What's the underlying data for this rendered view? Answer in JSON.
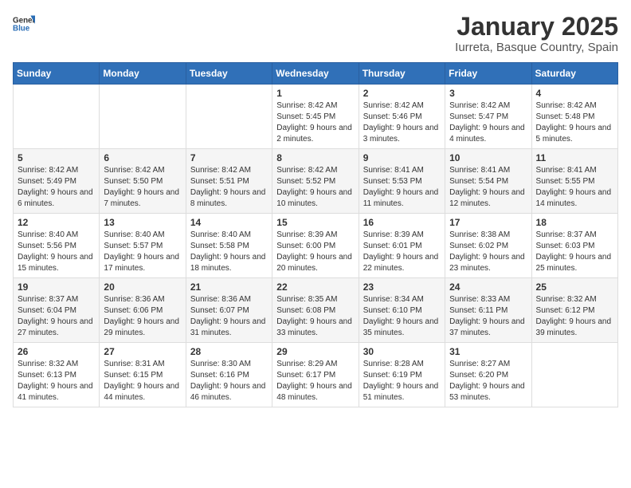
{
  "header": {
    "logo_general": "General",
    "logo_blue": "Blue",
    "title": "January 2025",
    "subtitle": "Iurreta, Basque Country, Spain"
  },
  "weekdays": [
    "Sunday",
    "Monday",
    "Tuesday",
    "Wednesday",
    "Thursday",
    "Friday",
    "Saturday"
  ],
  "weeks": [
    [
      {
        "day": "",
        "sunrise": "",
        "sunset": "",
        "daylight": ""
      },
      {
        "day": "",
        "sunrise": "",
        "sunset": "",
        "daylight": ""
      },
      {
        "day": "",
        "sunrise": "",
        "sunset": "",
        "daylight": ""
      },
      {
        "day": "1",
        "sunrise": "Sunrise: 8:42 AM",
        "sunset": "Sunset: 5:45 PM",
        "daylight": "Daylight: 9 hours and 2 minutes."
      },
      {
        "day": "2",
        "sunrise": "Sunrise: 8:42 AM",
        "sunset": "Sunset: 5:46 PM",
        "daylight": "Daylight: 9 hours and 3 minutes."
      },
      {
        "day": "3",
        "sunrise": "Sunrise: 8:42 AM",
        "sunset": "Sunset: 5:47 PM",
        "daylight": "Daylight: 9 hours and 4 minutes."
      },
      {
        "day": "4",
        "sunrise": "Sunrise: 8:42 AM",
        "sunset": "Sunset: 5:48 PM",
        "daylight": "Daylight: 9 hours and 5 minutes."
      }
    ],
    [
      {
        "day": "5",
        "sunrise": "Sunrise: 8:42 AM",
        "sunset": "Sunset: 5:49 PM",
        "daylight": "Daylight: 9 hours and 6 minutes."
      },
      {
        "day": "6",
        "sunrise": "Sunrise: 8:42 AM",
        "sunset": "Sunset: 5:50 PM",
        "daylight": "Daylight: 9 hours and 7 minutes."
      },
      {
        "day": "7",
        "sunrise": "Sunrise: 8:42 AM",
        "sunset": "Sunset: 5:51 PM",
        "daylight": "Daylight: 9 hours and 8 minutes."
      },
      {
        "day": "8",
        "sunrise": "Sunrise: 8:42 AM",
        "sunset": "Sunset: 5:52 PM",
        "daylight": "Daylight: 9 hours and 10 minutes."
      },
      {
        "day": "9",
        "sunrise": "Sunrise: 8:41 AM",
        "sunset": "Sunset: 5:53 PM",
        "daylight": "Daylight: 9 hours and 11 minutes."
      },
      {
        "day": "10",
        "sunrise": "Sunrise: 8:41 AM",
        "sunset": "Sunset: 5:54 PM",
        "daylight": "Daylight: 9 hours and 12 minutes."
      },
      {
        "day": "11",
        "sunrise": "Sunrise: 8:41 AM",
        "sunset": "Sunset: 5:55 PM",
        "daylight": "Daylight: 9 hours and 14 minutes."
      }
    ],
    [
      {
        "day": "12",
        "sunrise": "Sunrise: 8:40 AM",
        "sunset": "Sunset: 5:56 PM",
        "daylight": "Daylight: 9 hours and 15 minutes."
      },
      {
        "day": "13",
        "sunrise": "Sunrise: 8:40 AM",
        "sunset": "Sunset: 5:57 PM",
        "daylight": "Daylight: 9 hours and 17 minutes."
      },
      {
        "day": "14",
        "sunrise": "Sunrise: 8:40 AM",
        "sunset": "Sunset: 5:58 PM",
        "daylight": "Daylight: 9 hours and 18 minutes."
      },
      {
        "day": "15",
        "sunrise": "Sunrise: 8:39 AM",
        "sunset": "Sunset: 6:00 PM",
        "daylight": "Daylight: 9 hours and 20 minutes."
      },
      {
        "day": "16",
        "sunrise": "Sunrise: 8:39 AM",
        "sunset": "Sunset: 6:01 PM",
        "daylight": "Daylight: 9 hours and 22 minutes."
      },
      {
        "day": "17",
        "sunrise": "Sunrise: 8:38 AM",
        "sunset": "Sunset: 6:02 PM",
        "daylight": "Daylight: 9 hours and 23 minutes."
      },
      {
        "day": "18",
        "sunrise": "Sunrise: 8:37 AM",
        "sunset": "Sunset: 6:03 PM",
        "daylight": "Daylight: 9 hours and 25 minutes."
      }
    ],
    [
      {
        "day": "19",
        "sunrise": "Sunrise: 8:37 AM",
        "sunset": "Sunset: 6:04 PM",
        "daylight": "Daylight: 9 hours and 27 minutes."
      },
      {
        "day": "20",
        "sunrise": "Sunrise: 8:36 AM",
        "sunset": "Sunset: 6:06 PM",
        "daylight": "Daylight: 9 hours and 29 minutes."
      },
      {
        "day": "21",
        "sunrise": "Sunrise: 8:36 AM",
        "sunset": "Sunset: 6:07 PM",
        "daylight": "Daylight: 9 hours and 31 minutes."
      },
      {
        "day": "22",
        "sunrise": "Sunrise: 8:35 AM",
        "sunset": "Sunset: 6:08 PM",
        "daylight": "Daylight: 9 hours and 33 minutes."
      },
      {
        "day": "23",
        "sunrise": "Sunrise: 8:34 AM",
        "sunset": "Sunset: 6:10 PM",
        "daylight": "Daylight: 9 hours and 35 minutes."
      },
      {
        "day": "24",
        "sunrise": "Sunrise: 8:33 AM",
        "sunset": "Sunset: 6:11 PM",
        "daylight": "Daylight: 9 hours and 37 minutes."
      },
      {
        "day": "25",
        "sunrise": "Sunrise: 8:32 AM",
        "sunset": "Sunset: 6:12 PM",
        "daylight": "Daylight: 9 hours and 39 minutes."
      }
    ],
    [
      {
        "day": "26",
        "sunrise": "Sunrise: 8:32 AM",
        "sunset": "Sunset: 6:13 PM",
        "daylight": "Daylight: 9 hours and 41 minutes."
      },
      {
        "day": "27",
        "sunrise": "Sunrise: 8:31 AM",
        "sunset": "Sunset: 6:15 PM",
        "daylight": "Daylight: 9 hours and 44 minutes."
      },
      {
        "day": "28",
        "sunrise": "Sunrise: 8:30 AM",
        "sunset": "Sunset: 6:16 PM",
        "daylight": "Daylight: 9 hours and 46 minutes."
      },
      {
        "day": "29",
        "sunrise": "Sunrise: 8:29 AM",
        "sunset": "Sunset: 6:17 PM",
        "daylight": "Daylight: 9 hours and 48 minutes."
      },
      {
        "day": "30",
        "sunrise": "Sunrise: 8:28 AM",
        "sunset": "Sunset: 6:19 PM",
        "daylight": "Daylight: 9 hours and 51 minutes."
      },
      {
        "day": "31",
        "sunrise": "Sunrise: 8:27 AM",
        "sunset": "Sunset: 6:20 PM",
        "daylight": "Daylight: 9 hours and 53 minutes."
      },
      {
        "day": "",
        "sunrise": "",
        "sunset": "",
        "daylight": ""
      }
    ]
  ]
}
